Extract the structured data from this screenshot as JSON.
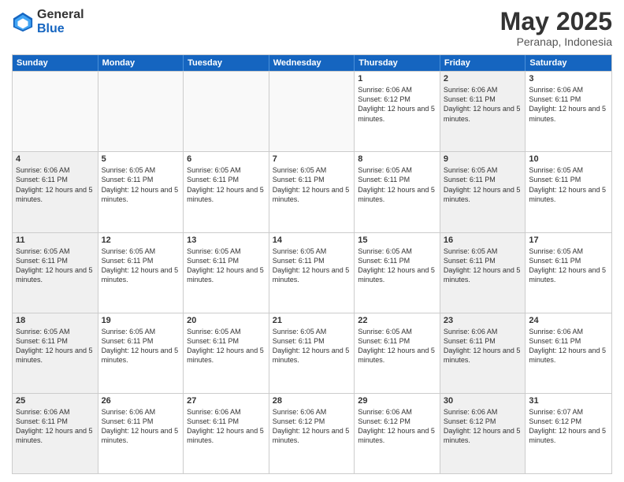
{
  "logo": {
    "general": "General",
    "blue": "Blue"
  },
  "header": {
    "month": "May 2025",
    "location": "Peranap, Indonesia"
  },
  "weekdays": [
    "Sunday",
    "Monday",
    "Tuesday",
    "Wednesday",
    "Thursday",
    "Friday",
    "Saturday"
  ],
  "weeks": [
    [
      {
        "day": "",
        "text": "",
        "empty": true
      },
      {
        "day": "",
        "text": "",
        "empty": true
      },
      {
        "day": "",
        "text": "",
        "empty": true
      },
      {
        "day": "",
        "text": "",
        "empty": true
      },
      {
        "day": "1",
        "text": "Sunrise: 6:06 AM\nSunset: 6:12 PM\nDaylight: 12 hours and 5 minutes.",
        "empty": false
      },
      {
        "day": "2",
        "text": "Sunrise: 6:06 AM\nSunset: 6:11 PM\nDaylight: 12 hours and 5 minutes.",
        "empty": false,
        "shaded": true
      },
      {
        "day": "3",
        "text": "Sunrise: 6:06 AM\nSunset: 6:11 PM\nDaylight: 12 hours and 5 minutes.",
        "empty": false
      }
    ],
    [
      {
        "day": "4",
        "text": "Sunrise: 6:06 AM\nSunset: 6:11 PM\nDaylight: 12 hours and 5 minutes.",
        "empty": false,
        "shaded": true
      },
      {
        "day": "5",
        "text": "Sunrise: 6:05 AM\nSunset: 6:11 PM\nDaylight: 12 hours and 5 minutes.",
        "empty": false
      },
      {
        "day": "6",
        "text": "Sunrise: 6:05 AM\nSunset: 6:11 PM\nDaylight: 12 hours and 5 minutes.",
        "empty": false
      },
      {
        "day": "7",
        "text": "Sunrise: 6:05 AM\nSunset: 6:11 PM\nDaylight: 12 hours and 5 minutes.",
        "empty": false
      },
      {
        "day": "8",
        "text": "Sunrise: 6:05 AM\nSunset: 6:11 PM\nDaylight: 12 hours and 5 minutes.",
        "empty": false
      },
      {
        "day": "9",
        "text": "Sunrise: 6:05 AM\nSunset: 6:11 PM\nDaylight: 12 hours and 5 minutes.",
        "empty": false,
        "shaded": true
      },
      {
        "day": "10",
        "text": "Sunrise: 6:05 AM\nSunset: 6:11 PM\nDaylight: 12 hours and 5 minutes.",
        "empty": false
      }
    ],
    [
      {
        "day": "11",
        "text": "Sunrise: 6:05 AM\nSunset: 6:11 PM\nDaylight: 12 hours and 5 minutes.",
        "empty": false,
        "shaded": true
      },
      {
        "day": "12",
        "text": "Sunrise: 6:05 AM\nSunset: 6:11 PM\nDaylight: 12 hours and 5 minutes.",
        "empty": false
      },
      {
        "day": "13",
        "text": "Sunrise: 6:05 AM\nSunset: 6:11 PM\nDaylight: 12 hours and 5 minutes.",
        "empty": false
      },
      {
        "day": "14",
        "text": "Sunrise: 6:05 AM\nSunset: 6:11 PM\nDaylight: 12 hours and 5 minutes.",
        "empty": false
      },
      {
        "day": "15",
        "text": "Sunrise: 6:05 AM\nSunset: 6:11 PM\nDaylight: 12 hours and 5 minutes.",
        "empty": false
      },
      {
        "day": "16",
        "text": "Sunrise: 6:05 AM\nSunset: 6:11 PM\nDaylight: 12 hours and 5 minutes.",
        "empty": false,
        "shaded": true
      },
      {
        "day": "17",
        "text": "Sunrise: 6:05 AM\nSunset: 6:11 PM\nDaylight: 12 hours and 5 minutes.",
        "empty": false
      }
    ],
    [
      {
        "day": "18",
        "text": "Sunrise: 6:05 AM\nSunset: 6:11 PM\nDaylight: 12 hours and 5 minutes.",
        "empty": false,
        "shaded": true
      },
      {
        "day": "19",
        "text": "Sunrise: 6:05 AM\nSunset: 6:11 PM\nDaylight: 12 hours and 5 minutes.",
        "empty": false
      },
      {
        "day": "20",
        "text": "Sunrise: 6:05 AM\nSunset: 6:11 PM\nDaylight: 12 hours and 5 minutes.",
        "empty": false
      },
      {
        "day": "21",
        "text": "Sunrise: 6:05 AM\nSunset: 6:11 PM\nDaylight: 12 hours and 5 minutes.",
        "empty": false
      },
      {
        "day": "22",
        "text": "Sunrise: 6:05 AM\nSunset: 6:11 PM\nDaylight: 12 hours and 5 minutes.",
        "empty": false
      },
      {
        "day": "23",
        "text": "Sunrise: 6:06 AM\nSunset: 6:11 PM\nDaylight: 12 hours and 5 minutes.",
        "empty": false,
        "shaded": true
      },
      {
        "day": "24",
        "text": "Sunrise: 6:06 AM\nSunset: 6:11 PM\nDaylight: 12 hours and 5 minutes.",
        "empty": false
      }
    ],
    [
      {
        "day": "25",
        "text": "Sunrise: 6:06 AM\nSunset: 6:11 PM\nDaylight: 12 hours and 5 minutes.",
        "empty": false,
        "shaded": true
      },
      {
        "day": "26",
        "text": "Sunrise: 6:06 AM\nSunset: 6:11 PM\nDaylight: 12 hours and 5 minutes.",
        "empty": false
      },
      {
        "day": "27",
        "text": "Sunrise: 6:06 AM\nSunset: 6:11 PM\nDaylight: 12 hours and 5 minutes.",
        "empty": false
      },
      {
        "day": "28",
        "text": "Sunrise: 6:06 AM\nSunset: 6:12 PM\nDaylight: 12 hours and 5 minutes.",
        "empty": false
      },
      {
        "day": "29",
        "text": "Sunrise: 6:06 AM\nSunset: 6:12 PM\nDaylight: 12 hours and 5 minutes.",
        "empty": false
      },
      {
        "day": "30",
        "text": "Sunrise: 6:06 AM\nSunset: 6:12 PM\nDaylight: 12 hours and 5 minutes.",
        "empty": false,
        "shaded": true
      },
      {
        "day": "31",
        "text": "Sunrise: 6:07 AM\nSunset: 6:12 PM\nDaylight: 12 hours and 5 minutes.",
        "empty": false
      }
    ]
  ]
}
